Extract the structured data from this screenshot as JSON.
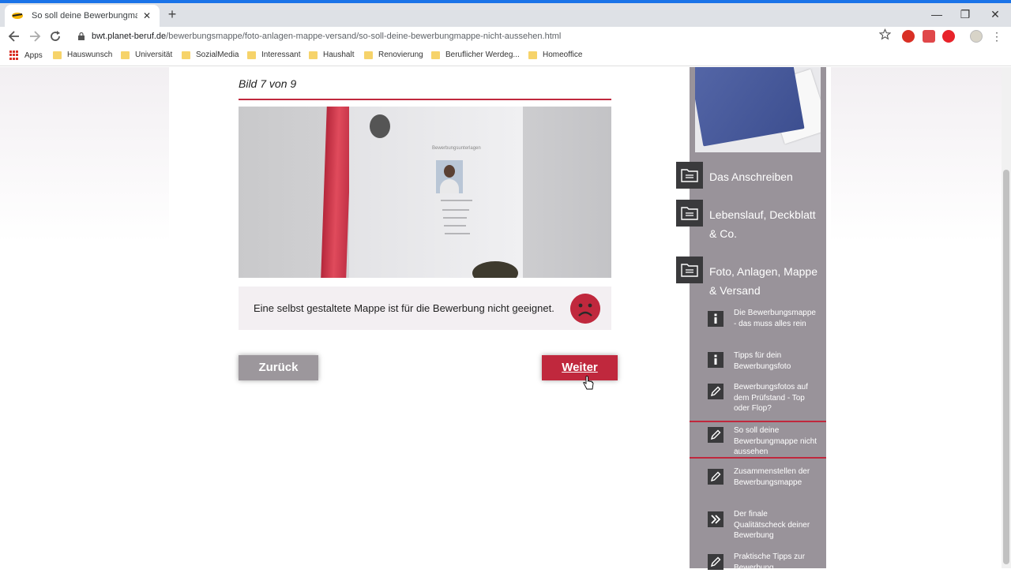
{
  "browser": {
    "tab_title": "So soll deine Bewerbungmappe",
    "tab_close": "✕",
    "new_tab": "+",
    "window_controls": {
      "minimize": "—",
      "restore": "❐",
      "close": "✕"
    },
    "url_domain": "bwt.planet-beruf.de",
    "url_path": "/bewerbungsmappe/foto-anlagen-mappe-versand/so-soll-deine-bewerbungmappe-nicht-aussehen.html",
    "bookmarks": [
      "Apps",
      "Hauswunsch",
      "Universität",
      "SozialMedia",
      "Interessant",
      "Haushalt",
      "Renovierung",
      "Beruflicher Werdeg...",
      "Homeoffice"
    ],
    "icons": {
      "back": "arrow-left-icon",
      "forward": "arrow-right-icon",
      "reload": "reload-icon",
      "star": "star-icon"
    }
  },
  "gallery": {
    "label": "Bild 7 von 9",
    "caption": "Eine selbst gestaltete Mappe ist für die Bewerbung nicht geeignet.",
    "photo_heading": "Bewerbungsunterlagen",
    "rating_icon": "sad-face-icon",
    "back_label": "Zurück",
    "next_label": "Weiter"
  },
  "sidebar": {
    "main_items": [
      {
        "label": "Das Anschreiben",
        "icon": "document-folder-icon"
      },
      {
        "label": "Lebenslauf, Deckblatt & Co.",
        "icon": "document-folder-icon"
      },
      {
        "label": "Foto, Anlagen, Mappe & Versand",
        "icon": "document-folder-icon"
      }
    ],
    "sub_items": [
      {
        "label": "Die Bewerbungsmappe - das muss alles rein",
        "icon": "info-icon"
      },
      {
        "label": "Tipps für dein Bewerbungsfoto",
        "icon": "info-icon"
      },
      {
        "label": "Bewerbungsfotos auf dem Prüfstand - Top oder Flop?",
        "icon": "pencil-icon"
      },
      {
        "label": "So soll deine Bewerbungmappe nicht aussehen",
        "icon": "pencil-icon",
        "active": true
      },
      {
        "label": "Zusammenstellen der Bewerbungsmappe",
        "icon": "pencil-icon"
      },
      {
        "label": "Der finale Qualitätscheck deiner Bewerbung",
        "icon": "double-chevron-right-icon"
      },
      {
        "label": "Praktische Tipps zur Bewerbung",
        "icon": "pencil-icon"
      }
    ]
  },
  "colors": {
    "accent": "#c0283d",
    "sidebar": "#99939a",
    "icon_box": "#3a3a3c",
    "back_button": "#9c979c"
  }
}
